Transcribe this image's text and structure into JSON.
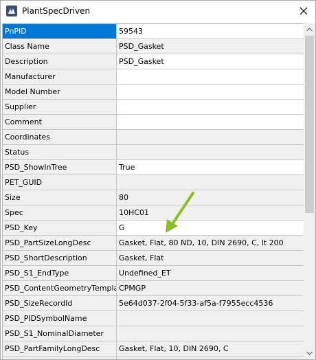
{
  "window": {
    "title": "PlantSpecDriven"
  },
  "icons": {
    "app": "app-icon",
    "close": "close-icon",
    "scroll_up": "scroll-up-arrow-icon",
    "scroll_down": "scroll-down-arrow-icon",
    "annotation": "green-arrow-annotation"
  },
  "colors": {
    "selection": "#0078d7",
    "readonly_bg": "#f0f0f0",
    "editable_bg": "#ffffff",
    "annotation": "#8cbf26"
  },
  "properties": [
    {
      "name": "PnPID",
      "value": "59543",
      "editable": true,
      "selected": true
    },
    {
      "name": "Class Name",
      "value": "PSD_Gasket",
      "editable": false
    },
    {
      "name": "Description",
      "value": "PSD_Gasket",
      "editable": true
    },
    {
      "name": "Manufacturer",
      "value": "",
      "editable": true
    },
    {
      "name": "Model Number",
      "value": "",
      "editable": true
    },
    {
      "name": "Supplier",
      "value": "",
      "editable": true
    },
    {
      "name": "Comment",
      "value": "",
      "editable": true
    },
    {
      "name": "Coordinates",
      "value": "",
      "editable": false
    },
    {
      "name": "Status",
      "value": "",
      "editable": false
    },
    {
      "name": "PSD_ShowInTree",
      "value": "True",
      "editable": true
    },
    {
      "name": "PET_GUID",
      "value": "",
      "editable": false
    },
    {
      "name": "Size",
      "value": "80",
      "editable": false
    },
    {
      "name": "Spec",
      "value": "10HC01",
      "editable": false
    },
    {
      "name": "PSD_Key",
      "value": "G",
      "editable": true
    },
    {
      "name": "PSD_PartSizeLongDesc",
      "value": "Gasket, Flat, 80 ND, 10, DIN 2690, C, lt 200",
      "editable": false
    },
    {
      "name": "PSD_ShortDescription",
      "value": "Gasket, Flat",
      "editable": false
    },
    {
      "name": "PSD_S1_EndType",
      "value": "Undefined_ET",
      "editable": false
    },
    {
      "name": "PSD_ContentGeometryTemplate",
      "value": "CPMGP",
      "editable": false
    },
    {
      "name": "PSD_SizeRecordId",
      "value": "5e64d037-2f04-5f33-af5a-f7955ecc4536",
      "editable": false
    },
    {
      "name": "PSD_PIDSymbolName",
      "value": "",
      "editable": false
    },
    {
      "name": "PSD_S1_NominalDiameter",
      "value": "",
      "editable": false
    },
    {
      "name": "PSD_PartFamilyLongDesc",
      "value": "Gasket, Flat, 10, DIN 2690, C",
      "editable": false
    },
    {
      "name": "",
      "value": "",
      "editable": false
    }
  ]
}
